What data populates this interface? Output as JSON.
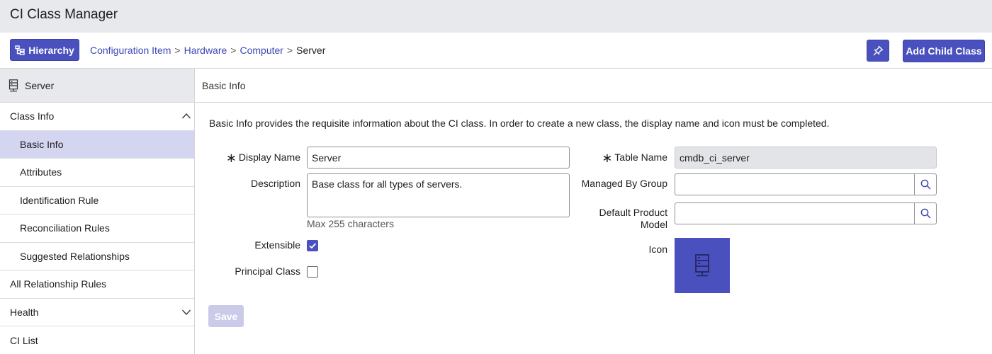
{
  "app": {
    "title": "CI Class Manager"
  },
  "toolbar": {
    "hierarchy_label": "Hierarchy",
    "breadcrumb": [
      "Configuration Item",
      "Hardware",
      "Computer",
      "Server"
    ],
    "breadcrumb_sep": ">",
    "add_child_label": "Add Child Class",
    "pin_icon": "pin-icon"
  },
  "sidebar": {
    "header": "Server",
    "header_icon": "server-icon",
    "items": [
      {
        "label": "Class Info",
        "expanded": true
      },
      {
        "label": "Basic Info",
        "active": true
      },
      {
        "label": "Attributes"
      },
      {
        "label": "Identification Rule"
      },
      {
        "label": "Reconciliation Rules"
      },
      {
        "label": "Suggested Relationships"
      },
      {
        "label": "All Relationship Rules"
      },
      {
        "label": "Health",
        "expanded": false
      },
      {
        "label": "CI List"
      }
    ]
  },
  "main": {
    "section_title": "Basic Info",
    "intro": "Basic Info provides the requisite information about the CI class. In order to create a new class, the display name and icon must be completed.",
    "form": {
      "display_name_label": "Display Name",
      "display_name_value": "Server",
      "description_label": "Description",
      "description_value": "Base class for all types of servers.",
      "description_hint": "Max 255 characters",
      "extensible_label": "Extensible",
      "extensible_checked": true,
      "principal_label": "Principal Class",
      "principal_checked": false,
      "table_name_label": "Table Name",
      "table_name_value": "cmdb_ci_server",
      "managed_by_label": "Managed By Group",
      "managed_by_value": "",
      "default_model_label_1": "Default Product",
      "default_model_label_2": "Model",
      "default_model_value": "",
      "icon_label": "Icon",
      "required_mark": "∗",
      "save_label": "Save"
    }
  },
  "colors": {
    "primary": "#4a51bf",
    "active_item": "#d4d6f1",
    "header_bg": "#e8e9ec",
    "link": "#3b47b5",
    "save_disabled": "#c9cbe9"
  }
}
